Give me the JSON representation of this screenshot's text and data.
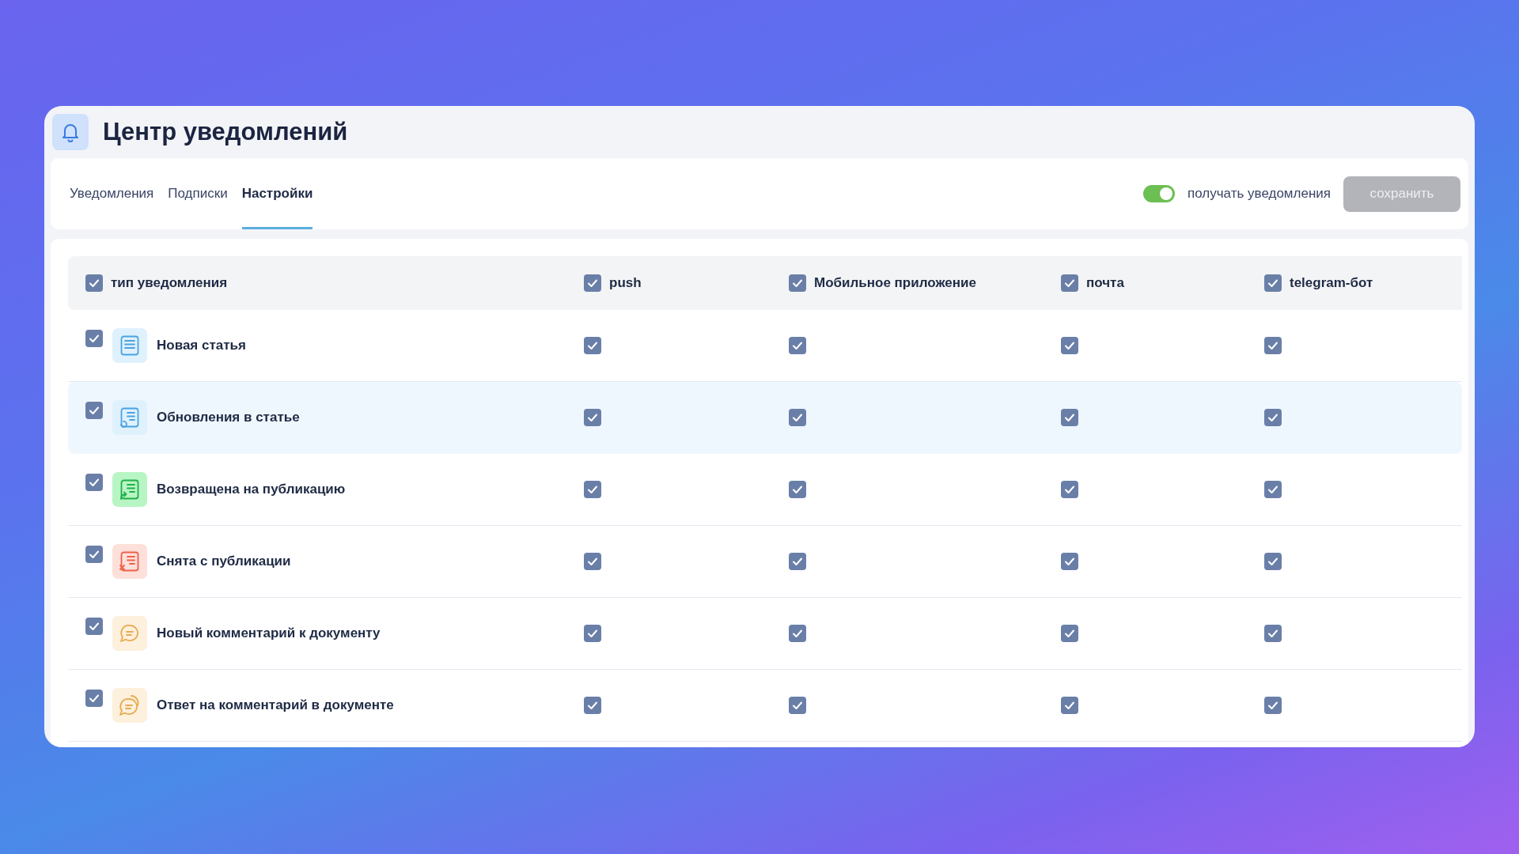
{
  "header": {
    "title": "Центр уведомлений"
  },
  "tabs": [
    {
      "label": "Уведомления",
      "selected": false
    },
    {
      "label": "Подписки",
      "selected": false
    },
    {
      "label": "Настройки",
      "selected": true
    }
  ],
  "receive_toggle": {
    "label": "получать уведомления",
    "on": true
  },
  "save_button": {
    "label": "сохранить",
    "disabled": true
  },
  "table": {
    "columns": [
      {
        "label": "тип уведомления",
        "checked": true
      },
      {
        "label": "push",
        "checked": true
      },
      {
        "label": "Мобильное приложение",
        "checked": true
      },
      {
        "label": "почта",
        "checked": true
      },
      {
        "label": "telegram-бот",
        "checked": true
      }
    ],
    "rows": [
      {
        "label": "Новая статья",
        "kind": "document",
        "color": "#4aa3e0",
        "highlighted": false,
        "checked": true,
        "channels": [
          true,
          true,
          true,
          true
        ]
      },
      {
        "label": "Обновления в статье",
        "kind": "document-update",
        "color": "#4aa3e0",
        "highlighted": true,
        "checked": true,
        "channels": [
          true,
          true,
          true,
          true
        ]
      },
      {
        "label": "Возвращена на публикацию",
        "kind": "document-return",
        "color": "#1fb04a",
        "highlighted": false,
        "checked": true,
        "channels": [
          true,
          true,
          true,
          true
        ]
      },
      {
        "label": "Снята с публикации",
        "kind": "document-remove",
        "color": "#f0604a",
        "highlighted": false,
        "checked": true,
        "channels": [
          true,
          true,
          true,
          true
        ]
      },
      {
        "label": "Новый комментарий к документу",
        "kind": "comment",
        "color": "#e8aa50",
        "highlighted": false,
        "checked": true,
        "channels": [
          true,
          true,
          true,
          true
        ]
      },
      {
        "label": "Ответ на комментарий в документе",
        "kind": "comments",
        "color": "#e8aa50",
        "highlighted": false,
        "checked": true,
        "channels": [
          true,
          true,
          true,
          true
        ]
      }
    ]
  }
}
